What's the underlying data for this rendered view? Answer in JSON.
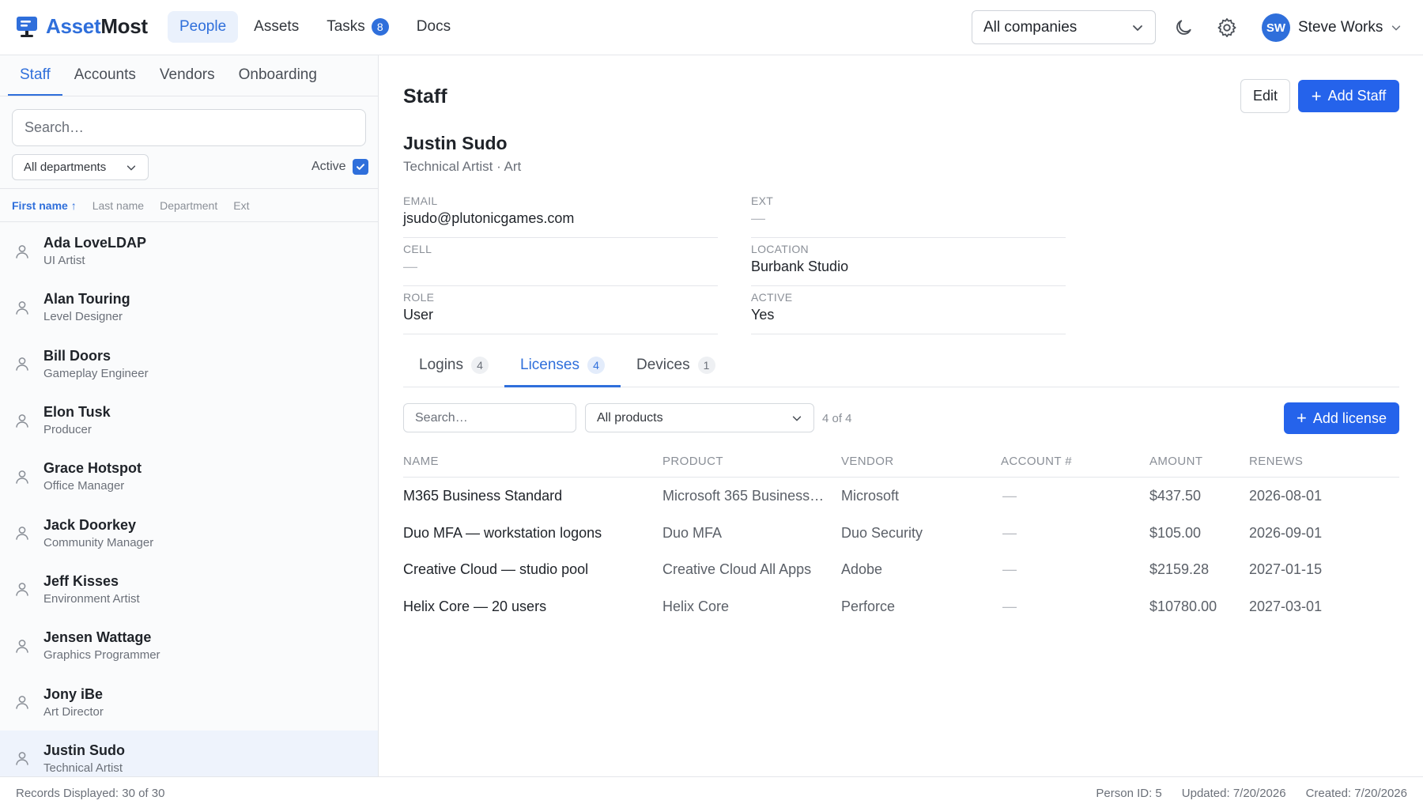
{
  "app": {
    "name_part1": "Asset",
    "name_part2": "Most",
    "nav": [
      {
        "label": "People",
        "active": true
      },
      {
        "label": "Assets"
      },
      {
        "label": "Tasks",
        "badge": "8"
      },
      {
        "label": "Docs"
      }
    ],
    "company_select": "All companies",
    "user": {
      "initials": "SW",
      "name": "Steve Works"
    },
    "icons": {
      "theme": "moon-icon",
      "settings": "gear-icon"
    },
    "accent_color": "#2f6fdb"
  },
  "sidebar": {
    "tabs": [
      "Staff",
      "Accounts",
      "Vendors",
      "Onboarding"
    ],
    "active_tab": "Staff",
    "search_placeholder": "Search…",
    "department_select": "All departments",
    "active_label": "Active",
    "active_checked": true,
    "sort_columns": [
      "First name ↑",
      "Last name",
      "Department",
      "Ext"
    ],
    "staff": [
      {
        "name": "Ada LoveLDAP",
        "title": "UI Artist"
      },
      {
        "name": "Alan Touring",
        "title": "Level Designer"
      },
      {
        "name": "Bill Doors",
        "title": "Gameplay Engineer"
      },
      {
        "name": "Elon Tusk",
        "title": "Producer"
      },
      {
        "name": "Grace Hotspot",
        "title": "Office Manager"
      },
      {
        "name": "Jack Doorkey",
        "title": "Community Manager"
      },
      {
        "name": "Jeff Kisses",
        "title": "Environment Artist"
      },
      {
        "name": "Jensen Wattage",
        "title": "Graphics Programmer"
      },
      {
        "name": "Jony iBe",
        "title": "Art Director"
      },
      {
        "name": "Justin Sudo",
        "title": "Technical Artist",
        "selected": true
      }
    ]
  },
  "main": {
    "title": "Staff",
    "edit_label": "Edit",
    "add_staff_label": "Add Staff",
    "person": {
      "name": "Justin Sudo",
      "subtitle": "Technical Artist · Art",
      "fields": [
        {
          "label": "EMAIL",
          "value": "jsudo@plutonicgames.com"
        },
        {
          "label": "EXT",
          "value": "—",
          "empty": true
        },
        {
          "label": "CELL",
          "value": "—",
          "empty": true
        },
        {
          "label": "LOCATION",
          "value": "Burbank Studio"
        },
        {
          "label": "ROLE",
          "value": "User"
        },
        {
          "label": "ACTIVE",
          "value": "Yes"
        }
      ]
    },
    "detail_tabs": [
      {
        "label": "Logins",
        "count": "4"
      },
      {
        "label": "Licenses",
        "count": "4",
        "active": true
      },
      {
        "label": "Devices",
        "count": "1"
      }
    ],
    "licenses": {
      "search_placeholder": "Search…",
      "product_select": "All products",
      "count_text": "4 of 4",
      "add_label": "Add license",
      "columns": [
        "NAME",
        "PRODUCT",
        "VENDOR",
        "ACCOUNT #",
        "AMOUNT",
        "RENEWS"
      ],
      "rows": [
        {
          "name": "M365 Business Standard",
          "product": "Microsoft 365 Business…",
          "vendor": "Microsoft",
          "account": "—",
          "amount": "$437.50",
          "renews": "2026-08-01"
        },
        {
          "name": "Duo MFA — workstation logons",
          "product": "Duo MFA",
          "vendor": "Duo Security",
          "account": "—",
          "amount": "$105.00",
          "renews": "2026-09-01"
        },
        {
          "name": "Creative Cloud — studio pool",
          "product": "Creative Cloud All Apps",
          "vendor": "Adobe",
          "account": "—",
          "amount": "$2159.28",
          "renews": "2027-01-15"
        },
        {
          "name": "Helix Core — 20 users",
          "product": "Helix Core",
          "vendor": "Perforce",
          "account": "—",
          "amount": "$10780.00",
          "renews": "2027-03-01"
        }
      ]
    }
  },
  "footer": {
    "records": "Records Displayed: 30 of 30",
    "person_id": "Person ID: 5",
    "updated": "Updated: 7/20/2026",
    "created": "Created: 7/20/2026"
  }
}
